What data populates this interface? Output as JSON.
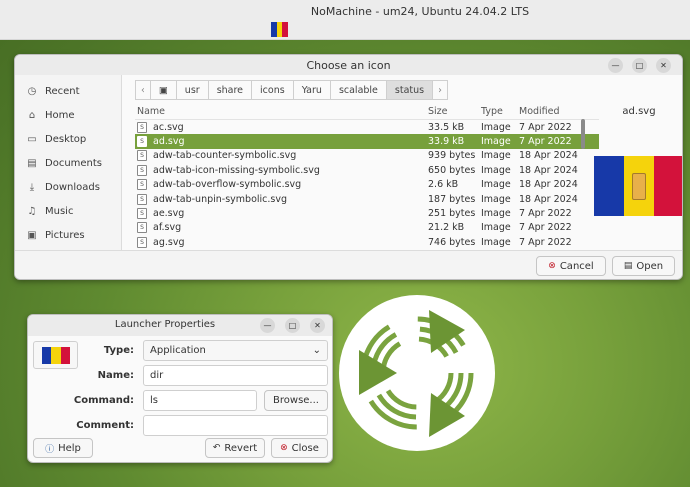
{
  "window_title": "NoMachine - um24, Ubuntu 24.04.2 LTS",
  "chooser": {
    "title": "Choose an icon",
    "sidebar": [
      {
        "icon": "clock-icon",
        "glyph": "◷",
        "label": "Recent"
      },
      {
        "icon": "home-icon",
        "glyph": "⌂",
        "label": "Home"
      },
      {
        "icon": "desktop-icon",
        "glyph": "▭",
        "label": "Desktop"
      },
      {
        "icon": "documents-icon",
        "glyph": "▤",
        "label": "Documents"
      },
      {
        "icon": "downloads-icon",
        "glyph": "⤓",
        "label": "Downloads"
      },
      {
        "icon": "music-icon",
        "glyph": "♫",
        "label": "Music"
      },
      {
        "icon": "pictures-icon",
        "glyph": "▣",
        "label": "Pictures"
      }
    ],
    "path": [
      "usr",
      "share",
      "icons",
      "Yaru",
      "scalable",
      "status"
    ],
    "columns": {
      "name": "Name",
      "size": "Size",
      "type": "Type",
      "modified": "Modified"
    },
    "files": [
      {
        "name": "ac.svg",
        "size": "33.5 kB",
        "type": "Image",
        "modified": "7 Apr 2022",
        "selected": false
      },
      {
        "name": "ad.svg",
        "size": "33.9 kB",
        "type": "Image",
        "modified": "7 Apr 2022",
        "selected": true
      },
      {
        "name": "adw-tab-counter-symbolic.svg",
        "size": "939 bytes",
        "type": "Image",
        "modified": "18 Apr 2024",
        "selected": false
      },
      {
        "name": "adw-tab-icon-missing-symbolic.svg",
        "size": "650 bytes",
        "type": "Image",
        "modified": "18 Apr 2024",
        "selected": false
      },
      {
        "name": "adw-tab-overflow-symbolic.svg",
        "size": "2.6 kB",
        "type": "Image",
        "modified": "18 Apr 2024",
        "selected": false
      },
      {
        "name": "adw-tab-unpin-symbolic.svg",
        "size": "187 bytes",
        "type": "Image",
        "modified": "18 Apr 2024",
        "selected": false
      },
      {
        "name": "ae.svg",
        "size": "251 bytes",
        "type": "Image",
        "modified": "7 Apr 2022",
        "selected": false
      },
      {
        "name": "af.svg",
        "size": "21.2 kB",
        "type": "Image",
        "modified": "7 Apr 2022",
        "selected": false
      },
      {
        "name": "ag.svg",
        "size": "746 bytes",
        "type": "Image",
        "modified": "7 Apr 2022",
        "selected": false
      }
    ],
    "preview_name": "ad.svg",
    "cancel_label": "Cancel",
    "open_label": "Open"
  },
  "launcher": {
    "title": "Launcher Properties",
    "type_label": "Type:",
    "type_value": "Application",
    "name_label": "Name:",
    "name_value": "dir",
    "command_label": "Command:",
    "command_value": "ls",
    "browse_label": "Browse...",
    "comment_label": "Comment:",
    "comment_value": "",
    "help_label": "Help",
    "revert_label": "Revert",
    "close_label": "Close"
  },
  "colors": {
    "selection": "#77a03c",
    "flag_blue": "#1739a8",
    "flag_yellow": "#f5d30c",
    "flag_red": "#d3123b"
  }
}
